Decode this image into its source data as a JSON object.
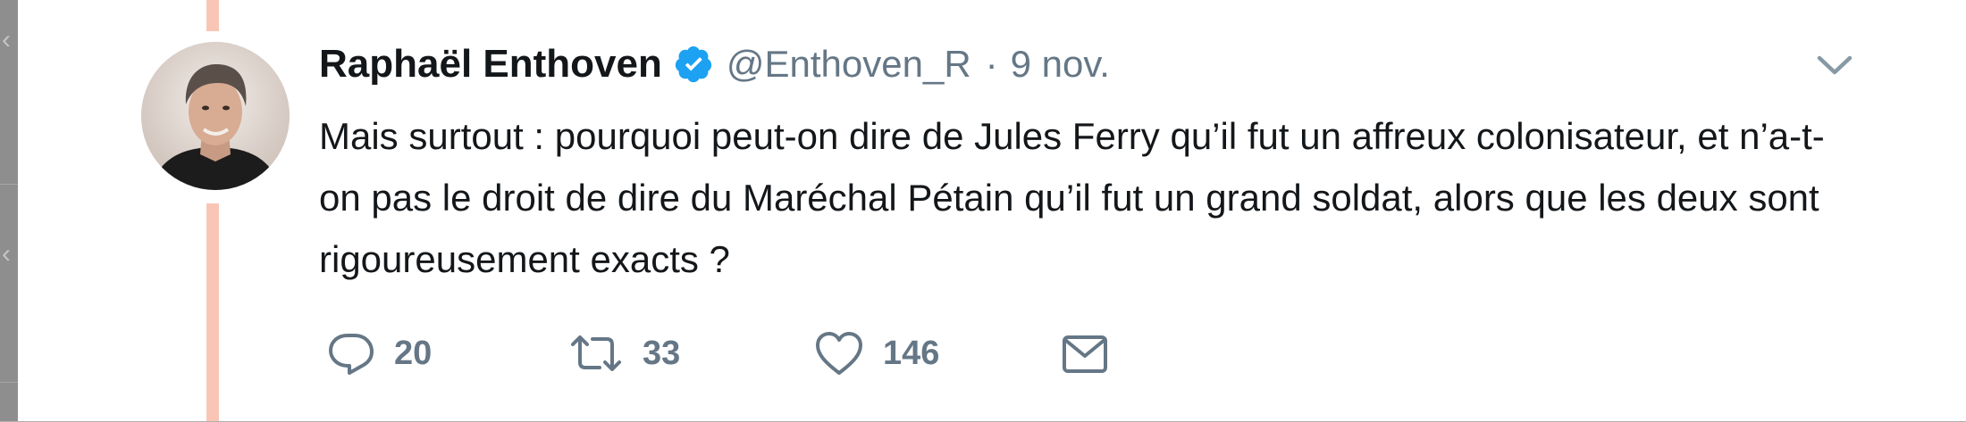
{
  "tweet": {
    "author": {
      "display_name": "Raphaël Enthoven",
      "handle": "@Enthoven_R",
      "verified": true
    },
    "separator": "·",
    "timestamp": "9 nov.",
    "text": "Mais surtout : pourquoi peut-on dire de Jules Ferry qu’il fut un affreux colonisateur, et n’a-t-on pas le droit de dire du Maréchal Pétain qu’il fut un grand soldat, alors que les deux sont rigoureusement exacts ?",
    "actions": {
      "reply_count": "20",
      "retweet_count": "33",
      "like_count": "146"
    }
  },
  "icons": {
    "verified": "verified-badge-icon",
    "caret": "chevron-down-icon",
    "reply": "reply-bubble-icon",
    "retweet": "retweet-icon",
    "like": "heart-icon",
    "dm": "envelope-icon",
    "gutter": "chevron-left-icon"
  },
  "colors": {
    "name": "#14171a",
    "secondary": "#657786",
    "verified": "#1da1f2",
    "thread_line": "#f9c6b5",
    "gutter": "#8e8e8e"
  }
}
